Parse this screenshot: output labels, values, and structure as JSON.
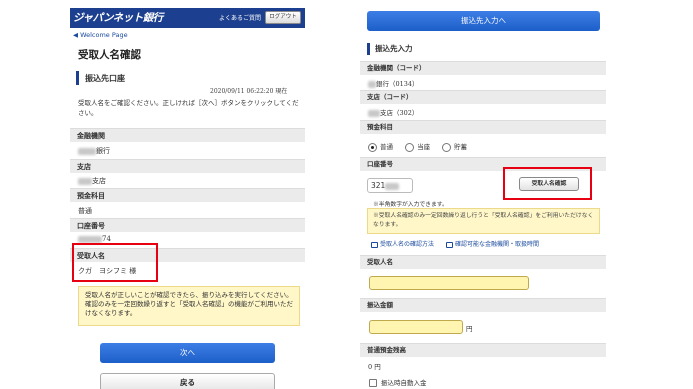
{
  "left_panel": {
    "header": {
      "logo": "ジャパンネット銀行",
      "faq_link": "よくあるご質問",
      "logout_button": "ログアウト"
    },
    "breadcrumb": "◀ Welcome Page",
    "page_title": "受取人名確認",
    "section_heading": "振込先口座",
    "datetime": "2020/09/11 06:22:20 現在",
    "instruction": "受取人名をご確認ください。正しければ［次へ］ボタンをクリックしてください。",
    "fields": {
      "bank_label": "金融機関",
      "bank_value_suffix": "銀行",
      "branch_label": "支店",
      "branch_value_suffix": "支店",
      "account_type_label": "預金科目",
      "account_type_value": "普通",
      "account_number_label": "口座番号",
      "account_number_value_suffix": "74",
      "recipient_label": "受取人名",
      "recipient_value": "クガ　ヨシフミ 様"
    },
    "notice": "受取人名が正しいことが確認できたら、振り込みを実行してください。確認のみを一定回数繰り返すと「受取人名確認」の機能がご利用いただけなくなります。",
    "next_button": "次へ",
    "back_button": "戻る"
  },
  "right_panel": {
    "top_button": "振込先入力へ",
    "section_heading": "振込先入力",
    "fields": {
      "bank_code_label": "金融機関（コード）",
      "bank_code_value": "銀行（0134）",
      "branch_code_label": "支店（コード）",
      "branch_code_value": "支店（302）",
      "account_type_label": "預金科目",
      "account_type_options": [
        "普通",
        "当座",
        "貯蓄"
      ],
      "account_type_selected": "普通",
      "account_number_label": "口座番号",
      "account_number_value": "321",
      "confirm_button": "受取人名確認",
      "account_number_hint": "※半角数字が入力できます。",
      "notice": "※受取人名確認のみ一定回数繰り返し行うと「受取人名確認」をご利用いただけなくなります。",
      "links": [
        "受取人名の確認方法",
        "確認可能な金融機関・取扱時間"
      ],
      "recipient_label": "受取人名",
      "amount_label": "振込金額",
      "amount_unit": "円",
      "balance_label": "普通預金残高",
      "balance_value": "0 円",
      "auto_deposit_label": "振込時自動入金"
    }
  },
  "colors": {
    "header_navy": "#1c3f8f",
    "primary_button": "#2a6fd8",
    "highlight_red": "#e60012",
    "notice_yellow": "#fff7c8",
    "input_yellow": "#fff4b0"
  }
}
